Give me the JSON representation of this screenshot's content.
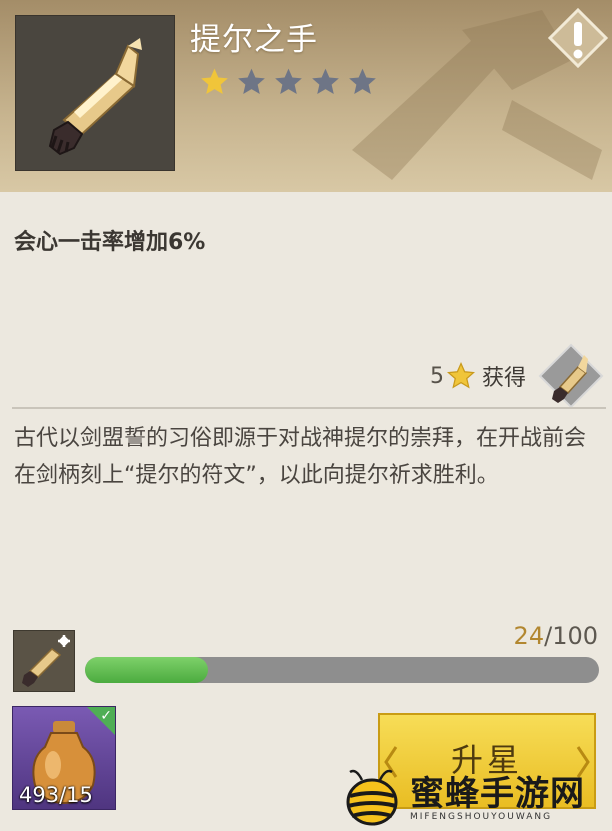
{
  "item": {
    "name": "提尔之手",
    "stars": {
      "filled": 1,
      "total": 5
    },
    "effect": "会心一击率增加6%",
    "lore": "古代以剑盟誓的习俗即源于对战神提尔的崇拜，在开战前会在剑柄刻上“提尔的符文”，以此向提尔祈求胜利。"
  },
  "obtain": {
    "stars_required": "5",
    "label": "获得"
  },
  "fragment_progress": {
    "current": "24",
    "separator": "/",
    "required": "100",
    "fraction": 0.24
  },
  "material": {
    "count": "493/15",
    "sufficient": true
  },
  "upgrade_button": {
    "label": "升星"
  },
  "alert_icon": "exclamation-icon",
  "watermark": {
    "title": "蜜蜂手游网",
    "subtitle": "MIFENGSHOUYOUWANG"
  },
  "colors": {
    "star_filled": "#f0c53a",
    "star_empty": "#6e7586",
    "progress_fill": "#5cbf4b",
    "button": "#f2cf3d",
    "header": "#b9a37c"
  }
}
